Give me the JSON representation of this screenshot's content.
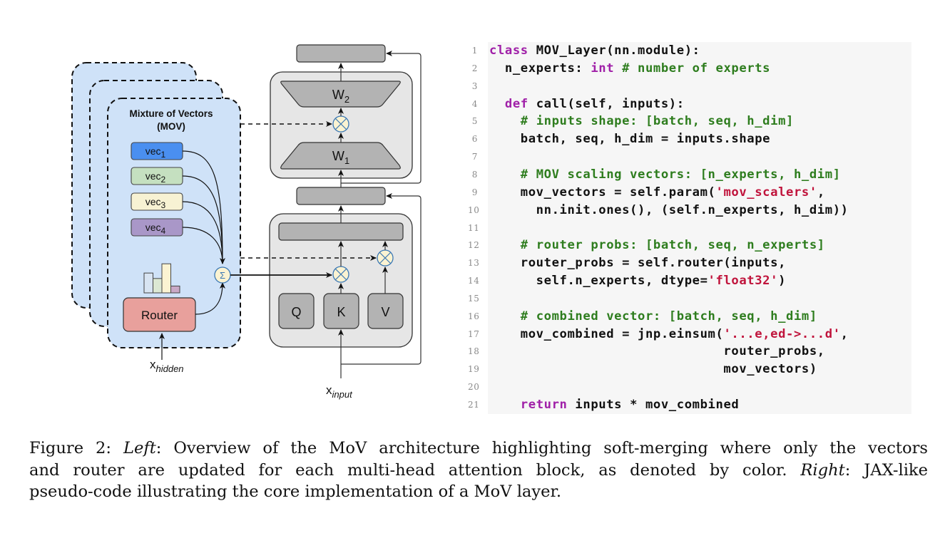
{
  "figure": {
    "diagram": {
      "mov_module": {
        "title_line1": "Mixture of Vectors",
        "title_line2": "(MOV)",
        "vectors": [
          {
            "label": "vec",
            "subscript": "1",
            "color": "#4a8ff0"
          },
          {
            "label": "vec",
            "subscript": "2",
            "color": "#c5e0c0"
          },
          {
            "label": "vec",
            "subscript": "3",
            "color": "#f7f2d3"
          },
          {
            "label": "vec",
            "subscript": "4",
            "color": "#a997c8"
          }
        ],
        "router_label": "Router",
        "router_color": "#e8a09c",
        "router_probs_bars": [
          0.58,
          0.42,
          0.85,
          0.2
        ],
        "router_bar_colors": [
          "#d8e4f2",
          "#dce8d3",
          "#fbf3d2",
          "#c9a8c6"
        ],
        "sum_symbol": "Σ",
        "input_label": "x",
        "input_subscript": "hidden",
        "panel_color": "#cfe2f8"
      },
      "ffn_block": {
        "w2_label": "W",
        "w2_subscript": "2",
        "w1_label": "W",
        "w1_subscript": "1"
      },
      "attention_block": {
        "q_label": "Q",
        "k_label": "K",
        "v_label": "V"
      },
      "multiply_symbol": "⊗",
      "input_label": "x",
      "input_subscript": "input"
    },
    "code": {
      "lines": [
        {
          "n": "1",
          "tokens": [
            {
              "t": "class",
              "c": "kw"
            },
            {
              "t": " MOV_Layer(nn.module):",
              "c": "tx"
            }
          ]
        },
        {
          "n": "2",
          "tokens": [
            {
              "t": "  n_experts: ",
              "c": "tx"
            },
            {
              "t": "int",
              "c": "kw"
            },
            {
              "t": " # number of experts",
              "c": "cm"
            }
          ]
        },
        {
          "n": "3",
          "tokens": []
        },
        {
          "n": "4",
          "tokens": [
            {
              "t": "  ",
              "c": "tx"
            },
            {
              "t": "def",
              "c": "kw"
            },
            {
              "t": " call(self, inputs):",
              "c": "tx"
            }
          ]
        },
        {
          "n": "5",
          "tokens": [
            {
              "t": "    ",
              "c": "tx"
            },
            {
              "t": "# inputs shape: [batch, seq, h_dim]",
              "c": "cm"
            }
          ]
        },
        {
          "n": "6",
          "tokens": [
            {
              "t": "    batch, seq, h_dim = inputs.shape",
              "c": "tx"
            }
          ]
        },
        {
          "n": "7",
          "tokens": []
        },
        {
          "n": "8",
          "tokens": [
            {
              "t": "    ",
              "c": "tx"
            },
            {
              "t": "# MOV scaling vectors: [n_experts, h_dim]",
              "c": "cm"
            }
          ]
        },
        {
          "n": "9",
          "tokens": [
            {
              "t": "    mov_vectors = self.param(",
              "c": "tx"
            },
            {
              "t": "'mov_scalers'",
              "c": "str"
            },
            {
              "t": ",",
              "c": "tx"
            }
          ]
        },
        {
          "n": "10",
          "tokens": [
            {
              "t": "      nn.init.ones(), (self.n_experts, h_dim))",
              "c": "tx"
            }
          ]
        },
        {
          "n": "11",
          "tokens": []
        },
        {
          "n": "12",
          "tokens": [
            {
              "t": "    ",
              "c": "tx"
            },
            {
              "t": "# router probs: [batch, seq, n_experts]",
              "c": "cm"
            }
          ]
        },
        {
          "n": "13",
          "tokens": [
            {
              "t": "    router_probs = self.router(inputs,",
              "c": "tx"
            }
          ]
        },
        {
          "n": "14",
          "tokens": [
            {
              "t": "      self.n_experts, dtype=",
              "c": "tx"
            },
            {
              "t": "'float32'",
              "c": "str"
            },
            {
              "t": ")",
              "c": "tx"
            }
          ]
        },
        {
          "n": "15",
          "tokens": []
        },
        {
          "n": "16",
          "tokens": [
            {
              "t": "    ",
              "c": "tx"
            },
            {
              "t": "# combined vector: [batch, seq, h_dim]",
              "c": "cm"
            }
          ]
        },
        {
          "n": "17",
          "tokens": [
            {
              "t": "    mov_combined = jnp.einsum(",
              "c": "tx"
            },
            {
              "t": "'...e,ed->...d'",
              "c": "str"
            },
            {
              "t": ",",
              "c": "tx"
            }
          ]
        },
        {
          "n": "18",
          "tokens": [
            {
              "t": "                              router_probs,",
              "c": "tx"
            }
          ]
        },
        {
          "n": "19",
          "tokens": [
            {
              "t": "                              mov_vectors)",
              "c": "tx"
            }
          ]
        },
        {
          "n": "20",
          "tokens": []
        },
        {
          "n": "21",
          "tokens": [
            {
              "t": "    ",
              "c": "tx"
            },
            {
              "t": "return",
              "c": "kw"
            },
            {
              "t": " inputs * mov_combined",
              "c": "tx"
            }
          ]
        }
      ]
    },
    "caption": {
      "label": "Figure 2:",
      "left_label": "Left",
      "part1": ": Overview of the MoV architecture highlighting soft-merging where only the vectors",
      "part2": "and router are updated for each multi-head attention block, as denoted by color.",
      "right_label": "Right",
      "part3": ": JAX-like",
      "part4": "pseudo-code illustrating the core implementation of a MoV layer."
    }
  }
}
